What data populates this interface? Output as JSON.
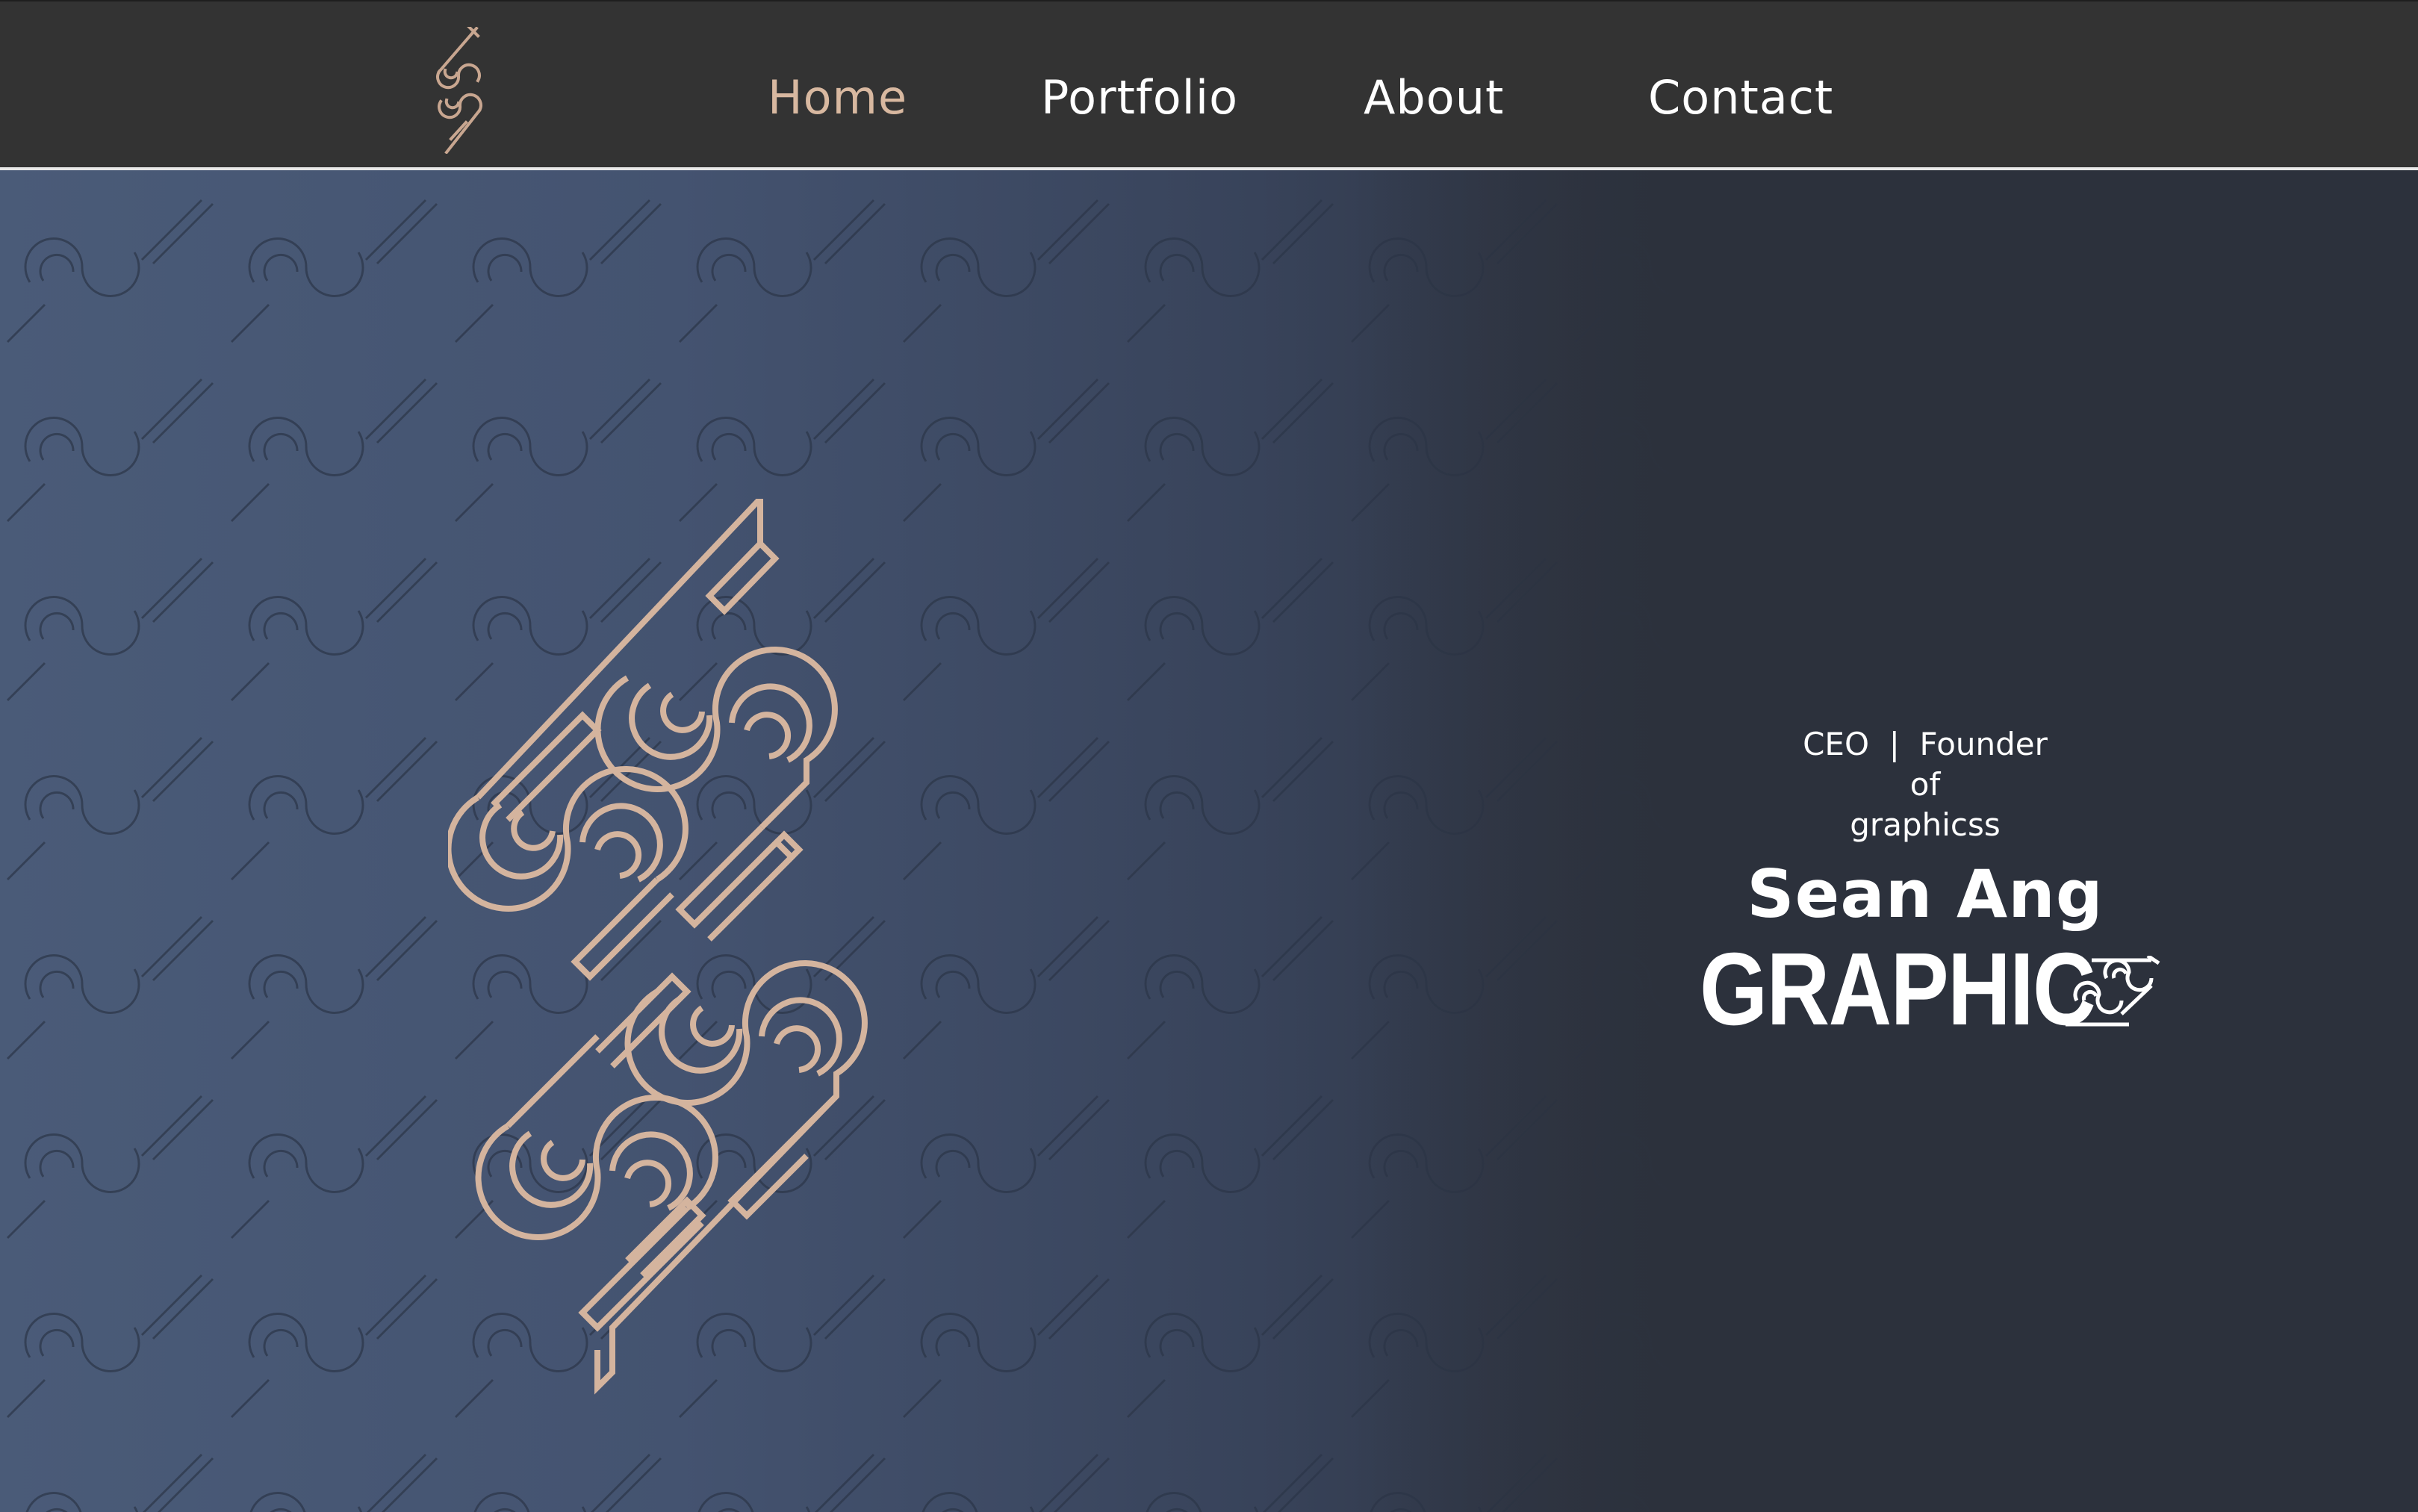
{
  "nav": {
    "items": [
      {
        "label": "Home",
        "active": true
      },
      {
        "label": "Portfolio",
        "active": false
      },
      {
        "label": "About",
        "active": false
      },
      {
        "label": "Contact",
        "active": false
      }
    ],
    "logo_icon": "graphicss-logo-icon"
  },
  "hero": {
    "tagline_line1": "CEO  |  Founder",
    "tagline_line2": "of",
    "tagline_line3": "graphicss",
    "name": "Sean Ang",
    "brand_text": "GRAPHIC",
    "brand_mark_icon": "graphicss-mark-icon",
    "big_logo_icon": "graphicss-large-logo-icon"
  },
  "colors": {
    "nav_bg": "#333333",
    "accent": "#d8b8a0",
    "hero_bg_left": "#4a5b78",
    "hero_bg_right": "#2c313c",
    "text": "#ffffff"
  }
}
